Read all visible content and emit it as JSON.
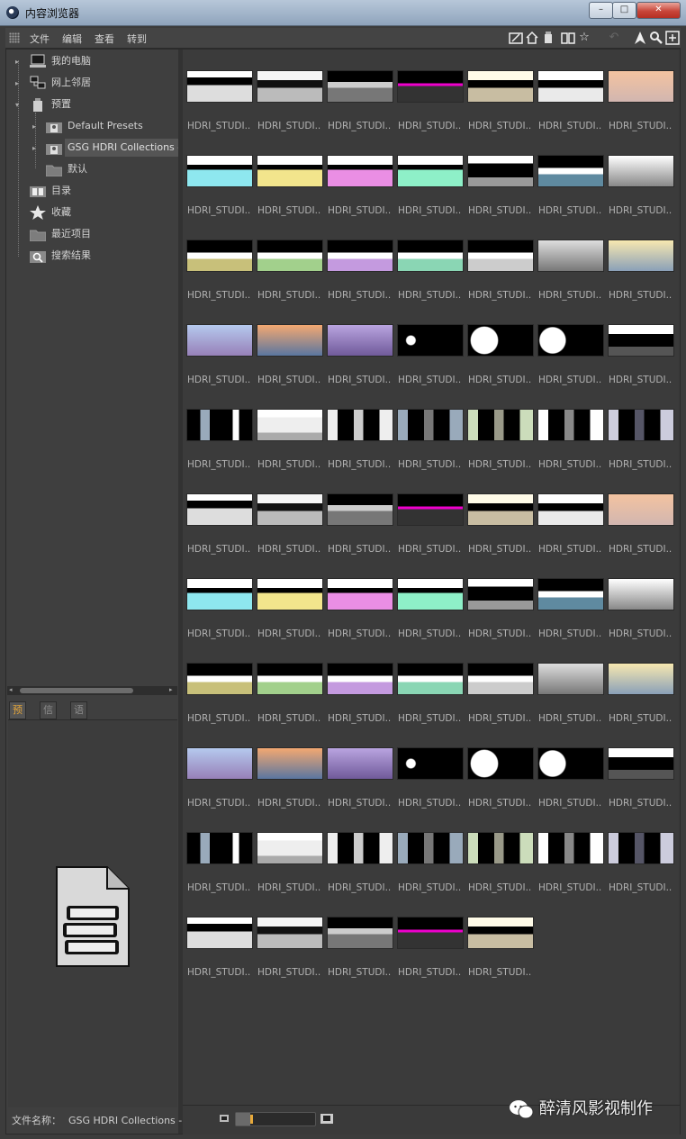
{
  "window": {
    "title": "内容浏览器",
    "minimize": "–",
    "maximize": "□",
    "close": "✕"
  },
  "menu": [
    "文件",
    "编辑",
    "查看",
    "转到"
  ],
  "toolbar_icons": [
    "edit-icon",
    "home-icon",
    "bucket-icon",
    "book-icon",
    "star-icon",
    "back-icon",
    "up-arrow-icon",
    "search-icon",
    "add-icon"
  ],
  "tree": [
    {
      "label": "我的电脑",
      "icon": "computer-icon"
    },
    {
      "label": "网上邻居",
      "icon": "network-icon"
    },
    {
      "label": "预置",
      "icon": "preset-icon"
    },
    {
      "label": "Default Presets",
      "icon": "preset-db-icon"
    },
    {
      "label": "GSG HDRI Collections -",
      "icon": "preset-db-icon",
      "selected": true
    },
    {
      "label": "默认",
      "icon": "folder-icon"
    },
    {
      "label": "目录",
      "icon": "catalog-icon"
    },
    {
      "label": "收藏",
      "icon": "star-icon"
    },
    {
      "label": "最近项目",
      "icon": "folder-icon"
    },
    {
      "label": "搜索结果",
      "icon": "search-results-icon"
    }
  ],
  "tabs": [
    "预览",
    "信息",
    "语言"
  ],
  "bottom": {
    "filename_label": "文件名称：",
    "filename_value": "GSG HDRI Collections -"
  },
  "item_caption": "HDRI_STUDI..",
  "thumb_count": 75,
  "watermark": "醉清风影视制作"
}
